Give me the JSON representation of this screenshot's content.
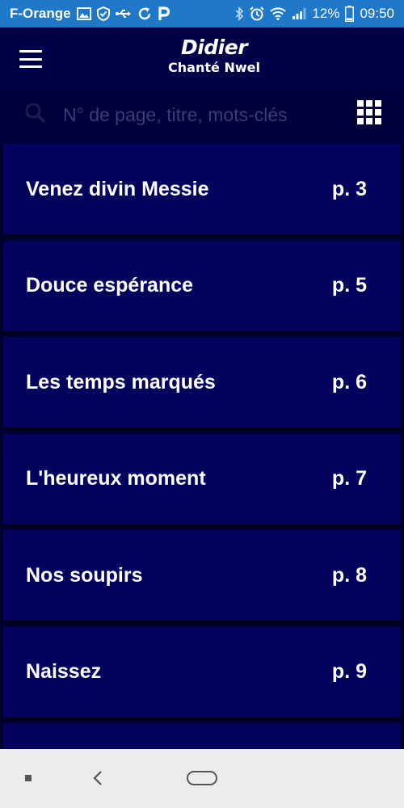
{
  "status_bar": {
    "carrier": "F-Orange",
    "battery_percent": "12%",
    "time": "09:50",
    "left_icons": [
      "image-icon",
      "shield-check-icon",
      "usb-icon",
      "sync-icon",
      "parking-icon"
    ],
    "right_icons": [
      "bluetooth-icon",
      "alarm-icon",
      "wifi-icon",
      "signal-icon",
      "battery-icon"
    ]
  },
  "header": {
    "logo_main": "Didier",
    "logo_sub": "Chanté Nwel"
  },
  "search": {
    "placeholder": "N° de page, titre, mots-clés"
  },
  "songs": [
    {
      "title": "Venez divin Messie",
      "page": "p. 3"
    },
    {
      "title": "Douce espérance",
      "page": "p. 5"
    },
    {
      "title": "Les temps marqués",
      "page": "p. 6"
    },
    {
      "title": "L'heureux moment",
      "page": "p. 7"
    },
    {
      "title": "Nos soupirs",
      "page": "p. 8"
    },
    {
      "title": "Naissez",
      "page": "p. 9"
    },
    {
      "title": "",
      "page": ""
    }
  ],
  "colors": {
    "status_bar": "#1f78c8",
    "background": "#000040",
    "list_item": "#03035e",
    "nav_bar": "#ececec"
  }
}
